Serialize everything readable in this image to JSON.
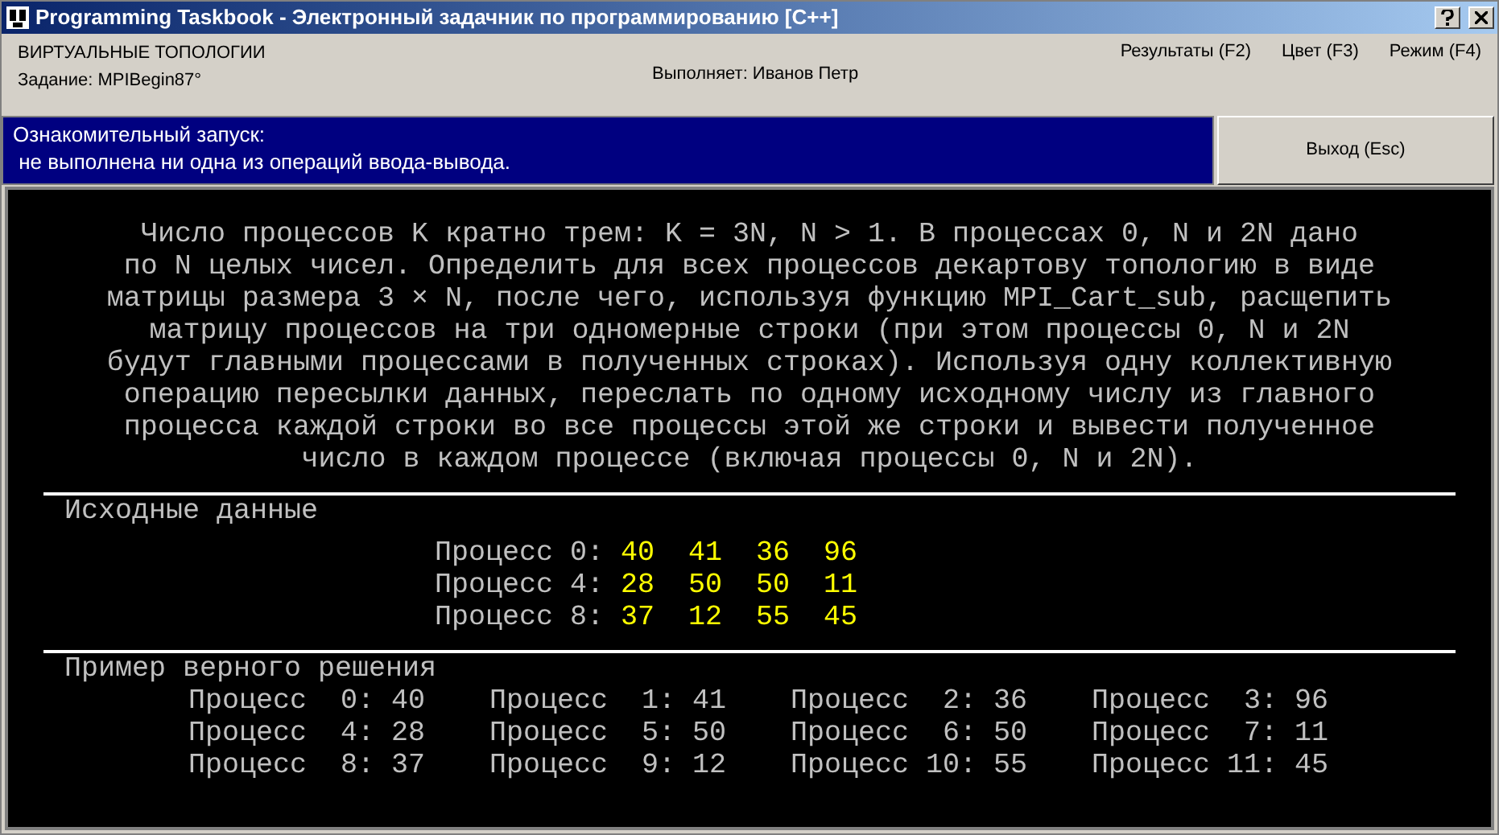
{
  "window": {
    "title": "Programming Taskbook - Электронный задачник по программированию [C++]"
  },
  "header": {
    "group": "ВИРТУАЛЬНЫЕ ТОПОЛОГИИ",
    "task": "Задание: MPIBegin87°",
    "performer": "Выполняет: Иванов Петр",
    "menu": [
      "Результаты (F2)",
      "Цвет (F3)",
      "Режим (F4)"
    ]
  },
  "status": {
    "lines": [
      "Ознакомительный запуск:",
      " не выполнена ни одна из операций ввода-вывода."
    ],
    "exit_button": "Выход (Esc)"
  },
  "description": [
    "Число процессов K кратно трем: K = 3N, N > 1. В процессах 0, N и 2N дано",
    "по N целых чисел. Определить для всех процессов декартову топологию в виде",
    "матрицы размера 3 × N, после чего, используя функцию MPI_Cart_sub, расщепить",
    "матрицу процессов на три одномерные строки (при этом процессы 0, N и 2N",
    "будут главными процессами в полученных строках). Используя одну коллективную",
    "операцию пересылки данных, переслать по одному исходному числу из главного",
    "процесса каждой строки во все процессы этой же строки и вывести полученное",
    "число в каждом процессе (включая процессы 0, N и 2N)."
  ],
  "input": {
    "title": "Исходные данные",
    "rows": [
      {
        "label": "Процесс 0:",
        "values": [
          "40",
          "41",
          "36",
          "96"
        ]
      },
      {
        "label": "Процесс 4:",
        "values": [
          "28",
          "50",
          "50",
          "11"
        ]
      },
      {
        "label": "Процесс 8:",
        "values": [
          "37",
          "12",
          "55",
          "45"
        ]
      }
    ]
  },
  "sample": {
    "title": "Пример верного решения",
    "rows": [
      [
        "Процесс  0: 40",
        "Процесс  1: 41",
        "Процесс  2: 36",
        "Процесс  3: 96"
      ],
      [
        "Процесс  4: 28",
        "Процесс  5: 50",
        "Процесс  6: 50",
        "Процесс  7: 11"
      ],
      [
        "Процесс  8: 37",
        "Процесс  9: 12",
        "Процесс 10: 55",
        "Процесс 11: 45"
      ]
    ]
  }
}
